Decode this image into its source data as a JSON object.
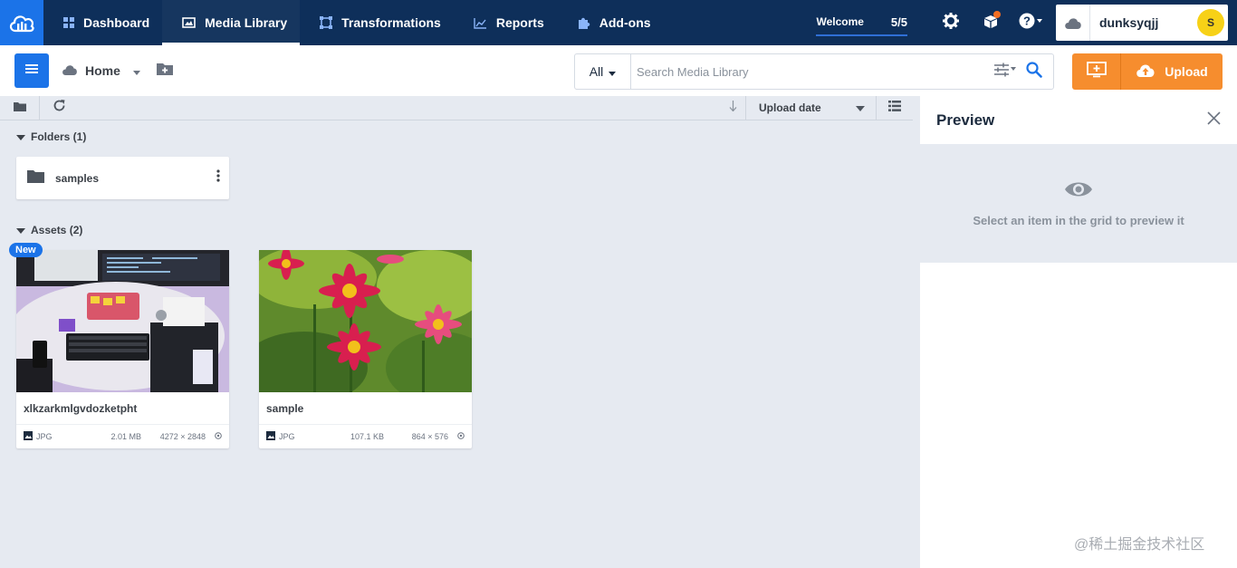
{
  "nav": {
    "tabs": [
      {
        "label": "Dashboard",
        "icon": "dashboard-icon"
      },
      {
        "label": "Media Library",
        "icon": "media-library-icon"
      },
      {
        "label": "Transformations",
        "icon": "transformations-icon"
      },
      {
        "label": "Reports",
        "icon": "reports-icon"
      },
      {
        "label": "Add-ons",
        "icon": "puzzle-icon"
      }
    ],
    "active_tab": "Media Library",
    "welcome_label": "Welcome",
    "welcome_count": "5/5",
    "username": "dunksyqjj",
    "avatar_initial": "S"
  },
  "subbar": {
    "home_label": "Home",
    "search_scope": "All",
    "search_placeholder": "Search Media Library",
    "upload_label": "Upload"
  },
  "toolbar": {
    "sort_label": "Upload date"
  },
  "folders": {
    "header": "Folders (1)",
    "items": [
      {
        "name": "samples"
      }
    ]
  },
  "assets": {
    "header": "Assets (2)",
    "items": [
      {
        "name": "xlkzarkmlgvdozketpht",
        "format": "JPG",
        "size": "2.01 MB",
        "dimensions": "4272 × 2848",
        "badge": "New"
      },
      {
        "name": "sample",
        "format": "JPG",
        "size": "107.1 KB",
        "dimensions": "864 × 576",
        "badge": ""
      }
    ]
  },
  "preview": {
    "title": "Preview",
    "empty_text": "Select an item in the grid to preview it"
  },
  "watermark": "@稀土掘金技术社区",
  "colors": {
    "nav_bg": "#0e2f5a",
    "accent_blue": "#1b73e8",
    "upload_orange": "#f68d2e",
    "content_bg": "#e6eaf1"
  }
}
